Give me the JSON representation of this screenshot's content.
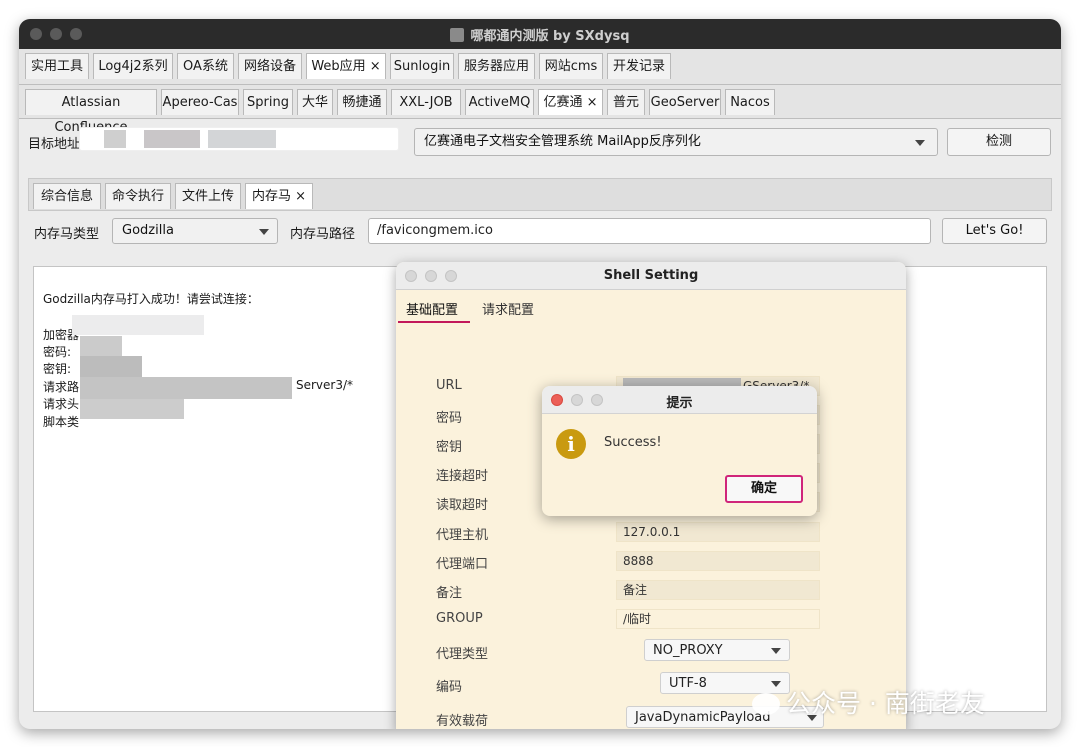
{
  "window": {
    "title": "哪都通内测版 by SXdysq"
  },
  "top_tabs": [
    {
      "label": "实用工具"
    },
    {
      "label": "Log4j2系列"
    },
    {
      "label": "OA系统"
    },
    {
      "label": "网络设备"
    },
    {
      "label": "Web应用 ×"
    },
    {
      "label": "Sunlogin"
    },
    {
      "label": "服务器应用"
    },
    {
      "label": "网站cms"
    },
    {
      "label": "开发记录"
    }
  ],
  "sub_tabs": [
    {
      "label": "Atlassian Confluence"
    },
    {
      "label": "Apereo-Cas"
    },
    {
      "label": "Spring"
    },
    {
      "label": "大华"
    },
    {
      "label": "畅捷通"
    },
    {
      "label": "XXL-JOB"
    },
    {
      "label": "ActiveMQ"
    },
    {
      "label": "亿赛通 ×"
    },
    {
      "label": "普元"
    },
    {
      "label": "GeoServer"
    },
    {
      "label": "Nacos"
    }
  ],
  "target": {
    "label": "目标地址",
    "exploit_selected": "亿赛通电子文档安全管理系统 MailApp反序列化",
    "detect_label": "检测"
  },
  "inner_tabs": [
    {
      "label": "综合信息"
    },
    {
      "label": "命令执行"
    },
    {
      "label": "文件上传"
    },
    {
      "label": "内存马 ×"
    }
  ],
  "memshell": {
    "type_label": "内存马类型",
    "type_value": "Godzilla",
    "path_label": "内存马路径",
    "path_value": "/favicongmem.ico",
    "go_label": "Let's Go!"
  },
  "output": {
    "line1": "Godzilla内存马打入成功！请尝试连接：",
    "line_encrypt": "加密器",
    "line_password": "密码:",
    "line_key": "密钥:",
    "line_path": "请求路",
    "line_path_suffix": "Server3/*",
    "line_header": "请求头",
    "line_script": "脚本类"
  },
  "shell_setting": {
    "title": "Shell Setting",
    "tabs": {
      "basic": "基础配置",
      "request": "请求配置"
    },
    "fields": {
      "url_label": "URL",
      "url_suffix": "GServer3/*",
      "password_label": "密码",
      "key_label": "密钥",
      "conn_timeout_label": "连接超时",
      "read_timeout_label": "读取超时",
      "proxy_host_label": "代理主机",
      "proxy_host_value": "127.0.0.1",
      "proxy_port_label": "代理端口",
      "proxy_port_value": "8888",
      "note_label": "备注",
      "note_value": "备注",
      "group_label": "GROUP",
      "group_value": "/临时",
      "proxy_type_label": "代理类型",
      "proxy_type_value": "NO_PROXY",
      "encoding_label": "编码",
      "encoding_value": "UTF-8",
      "payload_label": "有效载荷",
      "payload_value": "JavaDynamicPayload"
    }
  },
  "dialog": {
    "title": "提示",
    "message": "Success!",
    "ok_label": "确定"
  },
  "watermark": {
    "text": "公众号 · 南街老友"
  },
  "colors": {
    "highlight": "#d0257a",
    "info_icon": "#c99a10",
    "dialog_bg": "#fbf2dc",
    "titlebar": "#2b2b2b"
  }
}
